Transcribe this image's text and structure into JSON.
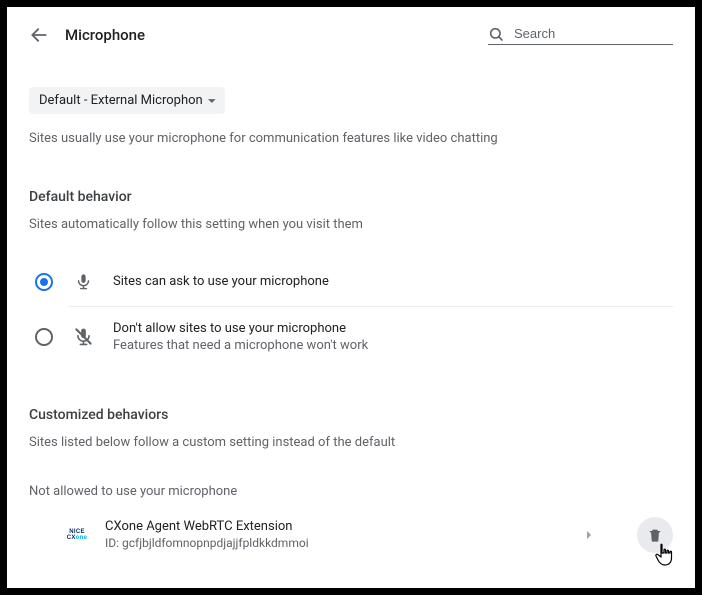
{
  "header": {
    "title": "Microphone",
    "search_placeholder": "Search"
  },
  "device": {
    "selected": "Default - External Microphone"
  },
  "intro": "Sites usually use your microphone for communication features like video chatting",
  "default_behavior": {
    "heading": "Default behavior",
    "sub": "Sites automatically follow this setting when you visit them",
    "options": [
      {
        "label": "Sites can ask to use your microphone",
        "sublabel": ""
      },
      {
        "label": "Don't allow sites to use your microphone",
        "sublabel": "Features that need a microphone won't work"
      }
    ]
  },
  "customized": {
    "heading": "Customized behaviors",
    "sub": "Sites listed below follow a custom setting instead of the default"
  },
  "not_allowed": {
    "heading": "Not allowed to use your microphone",
    "items": [
      {
        "name": "CXone Agent WebRTC Extension",
        "id_label": "ID: gcfjbjldfomnopnpdjajjfpldkkdmmoi"
      }
    ]
  }
}
